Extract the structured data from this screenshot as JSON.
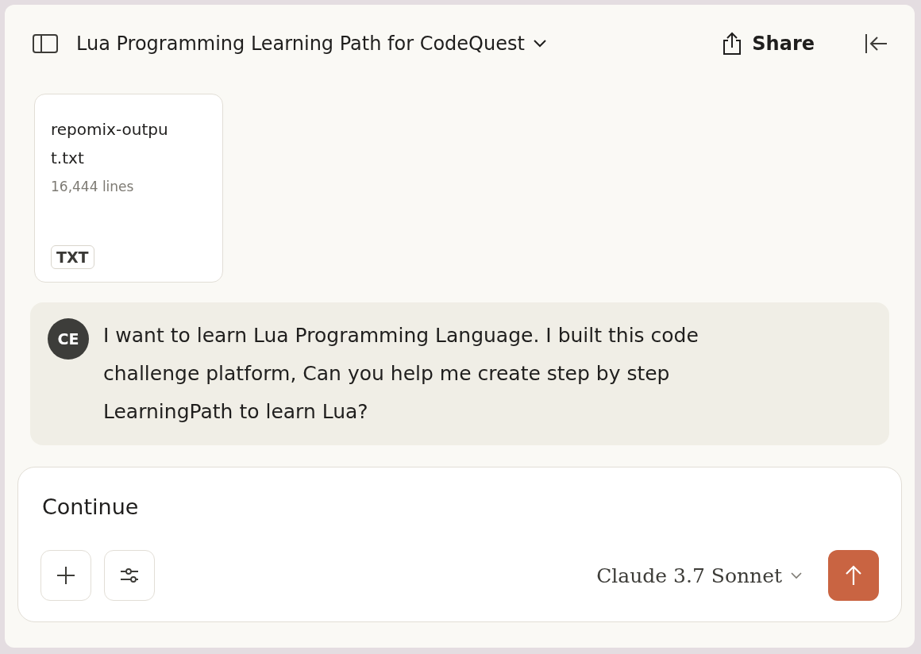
{
  "header": {
    "title": "Lua Programming Learning Path for CodeQuest",
    "share_label": "Share"
  },
  "attachment": {
    "name": "repomix-output.txt",
    "meta": "16,444 lines",
    "type": "TXT"
  },
  "message": {
    "avatar": "CE",
    "text": "I want to learn Lua Programming Language. I built this code challenge platform, Can you help me create step by step LearningPath to learn Lua?"
  },
  "composer": {
    "value": "Continue",
    "model": "Claude 3.7 Sonnet"
  }
}
